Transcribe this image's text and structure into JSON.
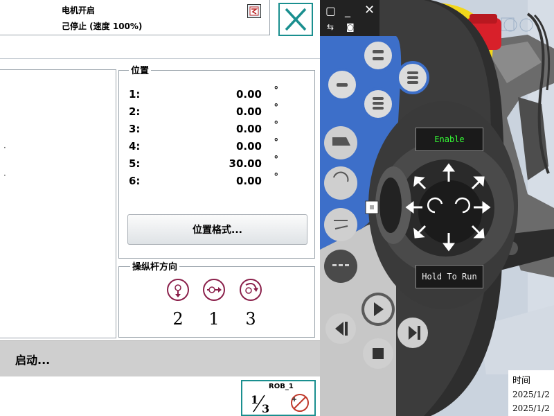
{
  "status": {
    "motor": "电机开启",
    "state": "己停止 (速度 100%)"
  },
  "positions": {
    "legend": "位置",
    "rows": [
      {
        "axis": "1:",
        "value": "0.00",
        "unit": "°"
      },
      {
        "axis": "2:",
        "value": "0.00",
        "unit": "°"
      },
      {
        "axis": "3:",
        "value": "0.00",
        "unit": "°"
      },
      {
        "axis": "4:",
        "value": "0.00",
        "unit": "°"
      },
      {
        "axis": "5:",
        "value": "30.00",
        "unit": "°"
      },
      {
        "axis": "6:",
        "value": "0.00",
        "unit": "°"
      }
    ],
    "format_button": "位置格式..."
  },
  "joystick": {
    "legend": "操纵杆方向",
    "directions": [
      "2",
      "1",
      "3"
    ]
  },
  "start_bar": {
    "label": "启动..."
  },
  "robot": {
    "name": "ROB_1",
    "increment": "1/3"
  },
  "pendant": {
    "enable_label": "Enable",
    "hold_label": "Hold To Run"
  },
  "taskbar": {
    "time_header": "时间",
    "dates": [
      "2025/1/2",
      "2025/1/2"
    ]
  },
  "colors": {
    "accent_teal": "#1a8f8f",
    "pendant_blue": "#3d6fc9",
    "emergency_red": "#d8202a",
    "pendant_yellow": "#f2d61b",
    "lcd_green": "#35ff35",
    "joystick_icon_maroon": "#8a1f4a"
  }
}
